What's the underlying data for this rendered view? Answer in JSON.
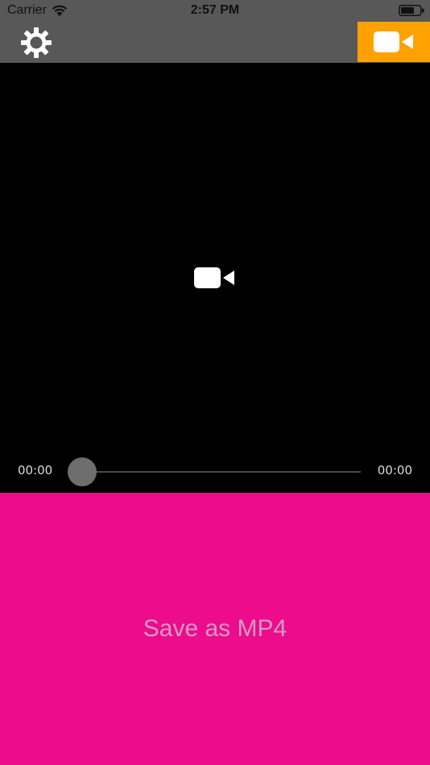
{
  "status_bar": {
    "carrier": "Carrier",
    "time": "2:57 PM"
  },
  "toolbar": {
    "settings_icon": "gear-icon",
    "camera_icon": "video-camera-icon",
    "accent_color": "#ffa100"
  },
  "player": {
    "placeholder_icon": "video-camera-icon",
    "current_time": "00:00",
    "total_time": "00:00",
    "progress": 0
  },
  "save": {
    "label": "Save as MP4",
    "background_color": "#ec0c8c"
  }
}
